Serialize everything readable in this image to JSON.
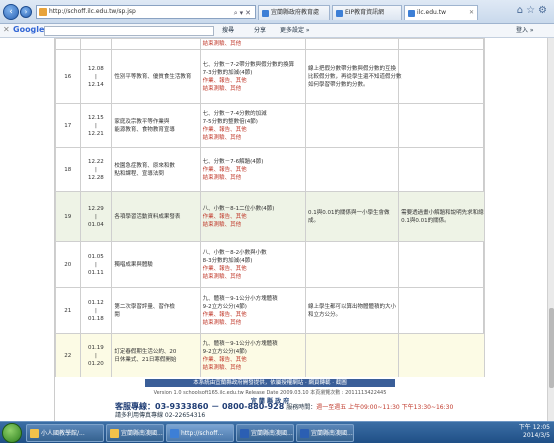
{
  "browser": {
    "url": "http://schoff.ilc.edu.tw/sp.jsp",
    "tabs": [
      {
        "label": "宜蘭縣政府教育處"
      },
      {
        "label": "EIP教育資訊網"
      },
      {
        "label": "ilc.edu.tw"
      }
    ],
    "google_bar": {
      "logo": "Google",
      "items": [
        "搜尋",
        "分享",
        "更多設定 »"
      ],
      "signin": "登入 »"
    }
  },
  "schedule": {
    "rows": [
      {
        "num": "",
        "date": [
          ""
        ],
        "unit": [
          ""
        ],
        "topic": [
          "結束測驗、其他"
        ],
        "c5": [],
        "c6": []
      },
      {
        "num": "16",
        "date": [
          "12.08",
          "|",
          "12.14"
        ],
        "unit": [
          "性別平等教育、優質食生活教育"
        ],
        "topic": [
          "七、分數－7-2帶分數與假分數的換算",
          "7-3分數的加減(4節)",
          "作業、報告、其他",
          "結束測驗、其他"
        ],
        "c5": [
          "線上把假分數帶分數與假分數的互換",
          "比較假分數，再從學生還不知道假分數",
          "如何學習帶分數的分數。"
        ],
        "c6": []
      },
      {
        "num": "17",
        "date": [
          "12.15",
          "|",
          "12.21"
        ],
        "unit": [
          "家庭及宗教平等作業與",
          "能源教育、食物教育宣導"
        ],
        "topic": [
          "七、分數－7-4分數的加減",
          "7-5分數的整數倍(4節)",
          "作業、報告、其他",
          "結束測驗、其他"
        ],
        "c5": [],
        "c6": []
      },
      {
        "num": "18",
        "date": [
          "12.22",
          "|",
          "12.28"
        ],
        "unit": [
          "校園急症教育、原來和數",
          "點和課程、宣導法問"
        ],
        "topic": [
          "七、分數－7-6解題(4節)",
          "作業、報告、其他",
          "結束測驗、其他"
        ],
        "c5": [],
        "c6": []
      },
      {
        "num": "19",
        "date": [
          "12.29",
          "|",
          "01.04"
        ],
        "unit": [
          "各項學習活動資料成果發表"
        ],
        "topic": [
          "八、小數－8-1二位小數(4節)",
          "作業、報告、其他",
          "結束測驗、其他"
        ],
        "c5": [
          "0.1與0.01的關係與一小學生會做",
          "成。"
        ],
        "c6": [
          "需要透過畫小解題和說明先求和總",
          "0.1與0.01的關係。"
        ]
      },
      {
        "num": "20",
        "date": [
          "01.05",
          "|",
          "01.11"
        ],
        "unit": [
          "獨唱成果與體驗"
        ],
        "topic": [
          "八、小數－8-2小數與小數",
          "8-3分數的加減(4節)",
          "作業、報告、其他",
          "結束測驗、其他"
        ],
        "c5": [],
        "c6": []
      },
      {
        "num": "21",
        "date": [
          "01.12",
          "|",
          "01.18"
        ],
        "unit": [
          "第二次學習評量、習作檢",
          "閱"
        ],
        "topic": [
          "九、體積－9-1公分小方塊體積",
          "9-2立方公分(4節)",
          "作業、報告、其他",
          "結束測驗、其他"
        ],
        "c5": [
          "線上學生都可以算出物體體積的大小",
          "和立方公分。"
        ],
        "c6": []
      },
      {
        "num": "22",
        "date": [
          "01.19",
          "|",
          "01.20"
        ],
        "unit": [
          "訂定春假期生活公約、20",
          "日休業式、21日寒假開始"
        ],
        "topic": [
          "九、體積－9-1公分小方塊體積",
          "9-2立方公分(4節)",
          "作業、報告、其他",
          "結束測驗、其他"
        ],
        "c5": [],
        "c6": []
      }
    ]
  },
  "footer": {
    "band": "本系統由宜蘭縣政府開發提供，依屬授權網站 ‧ 網頁轉載 ‧ 截圖",
    "version": "Version 1.0 schoolsoft165.ilc.edu.tw    Release Date 2009.03.10    本頁瀏覽次數 : 2011113422445",
    "org": "宜 蘭 縣 政 府",
    "hotline_label": "客服專線：",
    "hotline_numbers": "03-9333860 － 0800-880-928",
    "hotline_hours_label": "服務時間：",
    "hotline_hours": "週一至週五 上午09:00~11:30 下午13:30~16:30",
    "hotline_extra": "請多利用傳真專線 02-22654316"
  },
  "taskbar": {
    "tasks": [
      {
        "label": "小人國教學館/..."
      },
      {
        "label": "宜蘭縣南澳國..."
      },
      {
        "label": "http://schoff..."
      },
      {
        "label": "宜蘭縣南澳國..."
      },
      {
        "label": "宜蘭縣南澳國..."
      }
    ],
    "time": "下午 12:05",
    "date": "2014/3/5"
  },
  "colors": {
    "accent_red": "#c0392b",
    "footer_band": "#3a5e98",
    "row_alt": "#eef3e6",
    "row_yellow": "#fcfbe5"
  }
}
